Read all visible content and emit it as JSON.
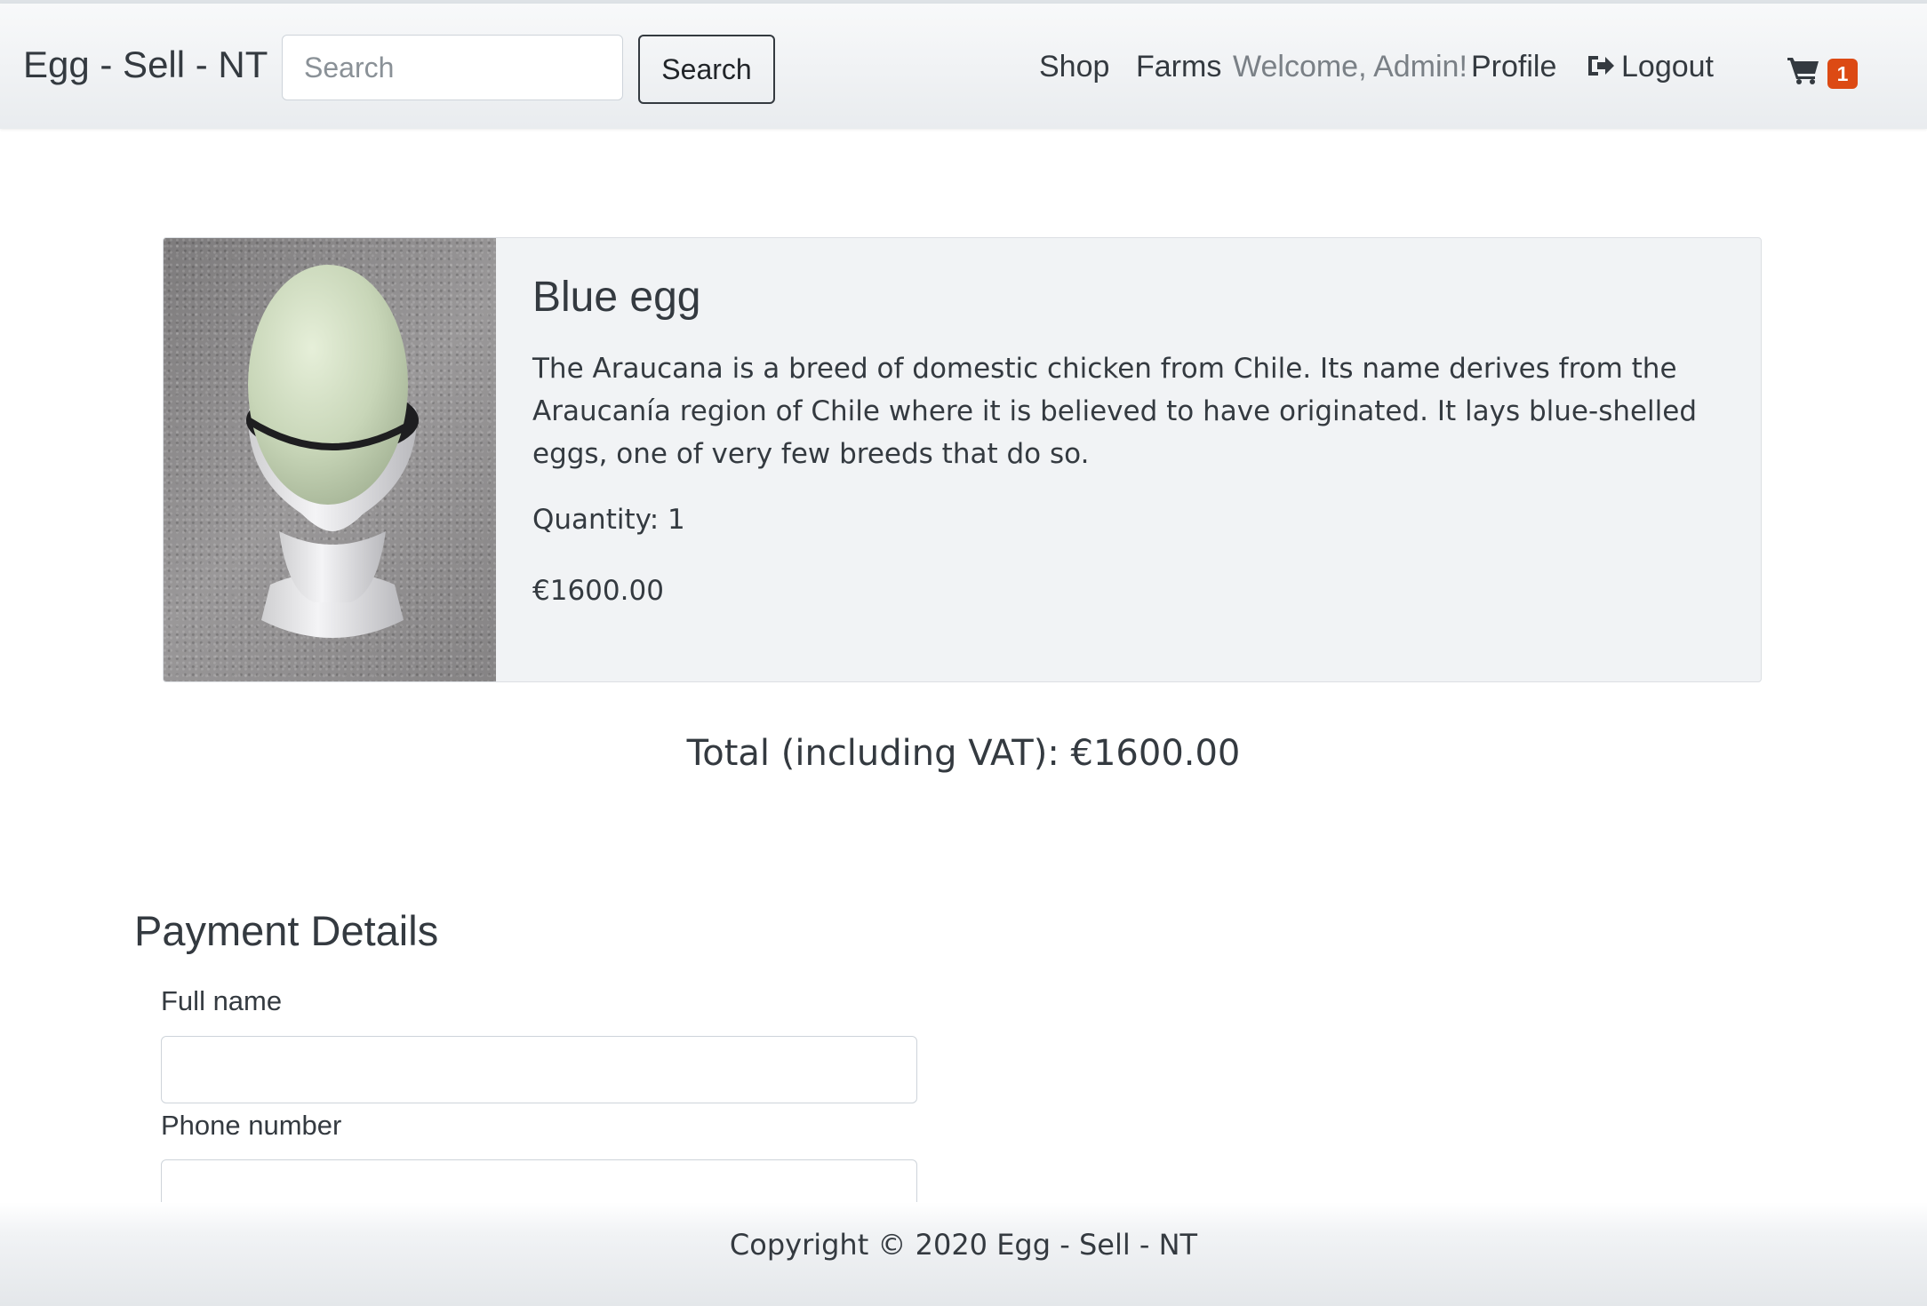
{
  "navbar": {
    "brand": "Egg - Sell - NT",
    "search_placeholder": "Search",
    "search_button": "Search",
    "links": {
      "shop": "Shop",
      "farms": "Farms",
      "welcome": "Welcome, Admin!",
      "profile": "Profile",
      "logout": "Logout"
    },
    "cart_count": "1",
    "cart_badge_color": "#dc4a14"
  },
  "product": {
    "title": "Blue egg",
    "description": "The Araucana is a breed of domestic chicken from Chile. Its name derives from the Araucanía region of Chile where it is believed to have originated. It lays blue-shelled eggs, one of very few breeds that do so.",
    "quantity": "Quantity: 1",
    "price": "€1600.00"
  },
  "total": "Total (including VAT): €1600.00",
  "payment": {
    "heading": "Payment Details",
    "full_name_label": "Full name",
    "phone_label": "Phone number",
    "full_name_value": "",
    "phone_value": ""
  },
  "footer": {
    "copyright": "Copyright © 2020 Egg - Sell - NT"
  },
  "icons": {
    "logout": "sign-out-icon",
    "cart": "shopping-cart-icon"
  }
}
